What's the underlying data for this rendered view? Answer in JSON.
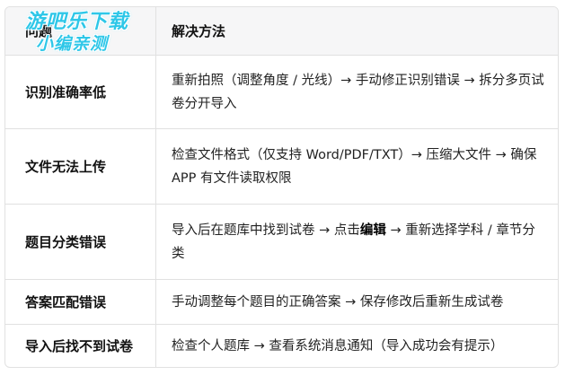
{
  "watermark": {
    "line1": "游吧乐下载",
    "line2": "小编亲测"
  },
  "table": {
    "headers": [
      "问题",
      "解决方法"
    ],
    "rows": [
      {
        "problem": "识别准确率低",
        "solution": "重新拍照（调整角度 / 光线）→ 手动修正识别错误 → 拆分多页试卷分开导入"
      },
      {
        "problem": "文件无法上传",
        "solution": "检查文件格式（仅支持 Word/PDF/TXT）→ 压缩大文件 → 确保 APP 有文件读取权限"
      },
      {
        "problem": "题目分类错误",
        "solution_before": "导入后在题库中找到试卷 → 点击",
        "solution_bold": "编辑",
        "solution_after": " → 重新选择学科 / 章节分类"
      },
      {
        "problem": "答案匹配错误",
        "solution": "手动调整每个题目的正确答案 → 保存修改后重新生成试卷"
      },
      {
        "problem": "导入后找不到试卷",
        "solution": "检查个人题库 → 查看系统消息通知（导入成功会有提示）"
      }
    ]
  }
}
